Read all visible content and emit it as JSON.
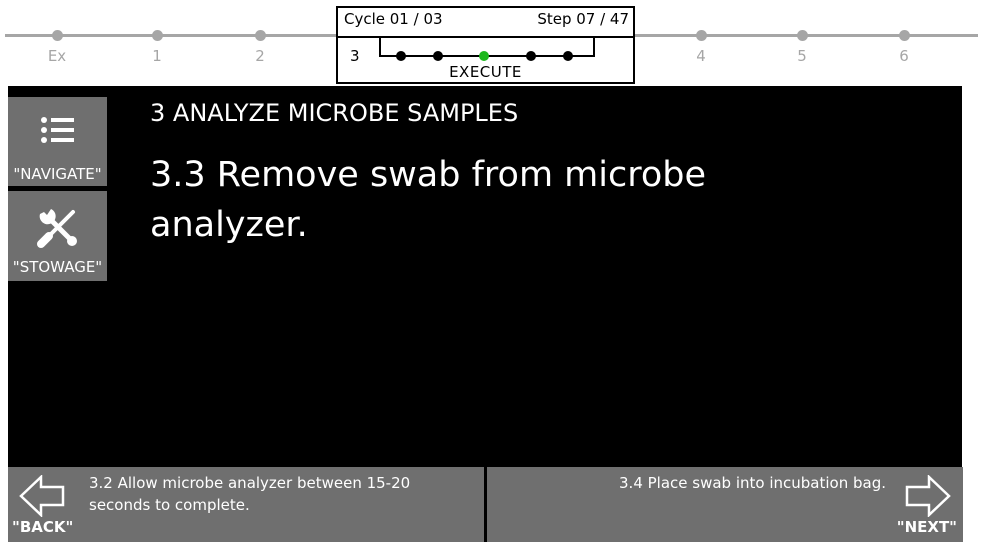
{
  "timeline": {
    "left_labels": [
      "Ex",
      "1",
      "2"
    ],
    "right_labels": [
      "4",
      "5",
      "6"
    ],
    "current": {
      "cycle": "Cycle 01 / 03",
      "step": "Step 07 / 47",
      "number": "3",
      "name": "EXECUTE"
    }
  },
  "sidebar": {
    "navigate_label": "\"NAVIGATE\"",
    "stowage_label": "\"STOWAGE\""
  },
  "main": {
    "section_title": "3 ANALYZE MICROBE SAMPLES",
    "step_title": "3.3 Remove swab from microbe analyzer."
  },
  "footer": {
    "back_text": "3.2 Allow microbe analyzer between 15-20 seconds to complete.",
    "back_label": "\"BACK\"",
    "next_text": "3.4 Place swab into incubation bag.",
    "next_label": "\"NEXT\""
  },
  "colors": {
    "active_node": "#1db81d",
    "inactive": "#a6a6a6",
    "panel": "#000000",
    "button": "#6f6f6f"
  }
}
